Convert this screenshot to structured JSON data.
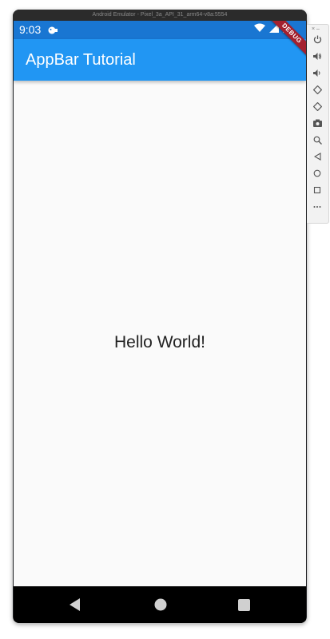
{
  "emulator": {
    "window_title": "Android Emulator - Pixel_3a_API_31_arm64-v8a:5554"
  },
  "status_bar": {
    "time": "9:03"
  },
  "app_bar": {
    "title": "AppBar Tutorial"
  },
  "debug_banner": {
    "label": "DEBUG"
  },
  "body": {
    "text": "Hello World!"
  },
  "colors": {
    "status_bar": "#1976d2",
    "app_bar": "#2196f3",
    "background": "#fafafa",
    "debug_banner": "#a3202e"
  },
  "navigation_bar": {
    "buttons": [
      "back-icon",
      "home-icon",
      "recents-icon"
    ]
  },
  "side_toolbar": {
    "top_controls": [
      "close-icon",
      "minimize-icon"
    ],
    "buttons": [
      "power-icon",
      "volume-up-icon",
      "volume-down-icon",
      "rotate-left-icon",
      "rotate-right-icon",
      "camera-icon",
      "zoom-icon",
      "back-icon",
      "home-icon",
      "overview-icon",
      "more-icon"
    ]
  }
}
